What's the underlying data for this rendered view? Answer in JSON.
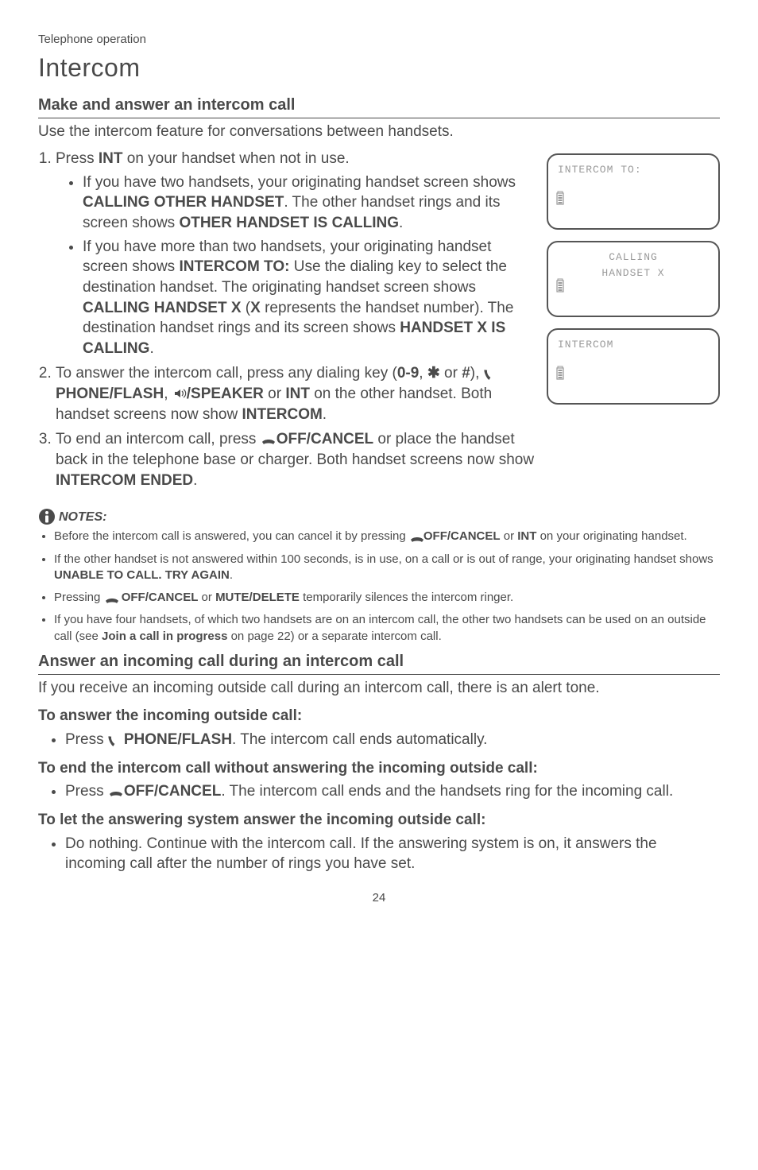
{
  "header_small": "Telephone operation",
  "title": "Intercom",
  "section1": {
    "heading": "Make and answer an intercom call",
    "intro": "Use the intercom feature for conversations between handsets.",
    "step1_prefix": "Press ",
    "step1_key": "INT",
    "step1_suffix": " on your handset when not in use.",
    "bullet1_a": "If you have two handsets, your originating handset screen shows ",
    "bullet1_b": "CALLING OTHER HANDSET",
    "bullet1_c": ". The other handset rings and its screen shows ",
    "bullet1_d": "OTHER HANDSET IS CALLING",
    "bullet1_e": ".",
    "bullet2_a": "If you have more than two handsets, your originating handset screen shows ",
    "bullet2_b": "INTERCOM TO:",
    "bullet2_c": " Use the dialing key to select the destination handset. The originating handset screen shows ",
    "bullet2_d": "CALLING HANDSET X",
    "bullet2_e": " (",
    "bullet2_f": "X",
    "bullet2_g": " represents the handset number). The destination handset rings and its screen shows ",
    "bullet2_h": "HANDSET X IS CALLING",
    "bullet2_i": ".",
    "step2_a": "To answer the intercom call, press any dialing key (",
    "step2_b": "0-9",
    "step2_c": ", ",
    "step2_asterisk": "✱",
    "step2_d": " or ",
    "step2_hash": "#",
    "step2_e": "), ",
    "step2_phone": "PHONE/",
    "step2_flash": "FLASH",
    "step2_f": ", ",
    "step2_speaker": "/SPEAKER",
    "step2_g": " or ",
    "step2_int": "INT",
    "step2_h": " on the other handset. Both handset screens now show ",
    "step2_intercom": "INTERCOM",
    "step2_i": ".",
    "step3_a": "To end an intercom call, press ",
    "step3_off": "OFF/",
    "step3_cancel": "CANCEL",
    "step3_b": " or place the handset back in the telephone base or charger. Both handset screens now show ",
    "step3_c": "INTERCOM ENDED",
    "step3_d": "."
  },
  "notes": {
    "label": "NOTES:",
    "n1_a": "Before the intercom call is answered, you can cancel it by pressing ",
    "n1_off": "OFF/CANCEL",
    "n1_b": " or ",
    "n1_int": "INT",
    "n1_c": " on your originating handset.",
    "n2_a": "If the other handset is not answered within 100 seconds, is in use, on a call or is out of range, your originating handset shows ",
    "n2_b": "UNABLE TO CALL. TRY AGAIN",
    "n2_c": ".",
    "n3_a": "Pressing ",
    "n3_off": "OFF/",
    "n3_cancel": "CANCEL",
    "n3_b": " or ",
    "n3_mute": "MUTE/",
    "n3_delete": "DELETE",
    "n3_c": " temporarily silences the intercom ringer.",
    "n4_a": "If you have four handsets, of which two handsets are on an intercom call, the other two handsets can be used on an outside call (see ",
    "n4_b": "Join a call in progress",
    "n4_c": " on page 22) or a separate intercom call."
  },
  "section2": {
    "heading": "Answer an incoming call during an intercom call",
    "intro": "If you receive an incoming outside call during an intercom call, there is an alert tone.",
    "h_answer": "To answer the incoming outside call:",
    "b_answer_a": "Press ",
    "b_answer_phone": "PHONE/",
    "b_answer_flash": "FLASH",
    "b_answer_b": ". The intercom call ends automatically.",
    "h_end": "To end the intercom call without answering the incoming outside call:",
    "b_end_a": "Press ",
    "b_end_off": "OFF/",
    "b_end_cancel": "CANCEL",
    "b_end_b": ". The intercom call ends and the handsets ring for the incoming call.",
    "h_let": "To let the answering system answer the incoming outside call:",
    "b_let": "Do nothing. Continue with the intercom call. If the answering system is on, it answers the incoming call after the number of rings you have set."
  },
  "screens": {
    "s1_line1": "INTERCOM TO:",
    "s2_line1": "CALLING",
    "s2_line2": "HANDSET X",
    "s3_line1": "INTERCOM"
  },
  "page": "24"
}
